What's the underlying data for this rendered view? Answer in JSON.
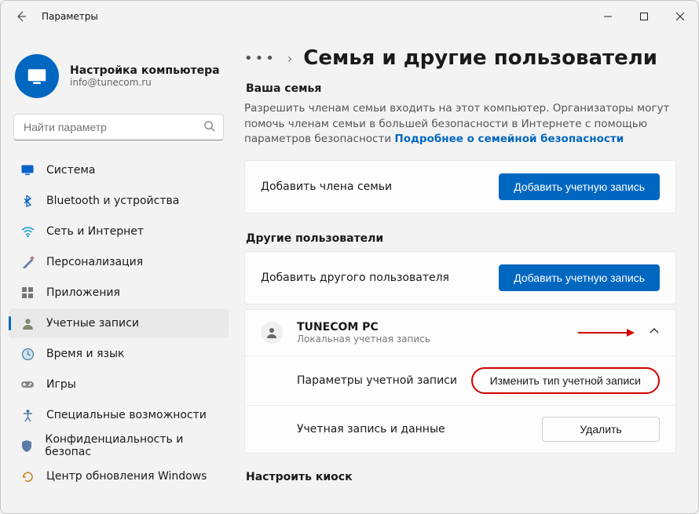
{
  "window": {
    "title": "Параметры"
  },
  "profile": {
    "name": "Настройка компьютера",
    "email": "info@tunecom.ru"
  },
  "search": {
    "placeholder": "Найти параметр"
  },
  "nav": {
    "items": [
      {
        "label": "Система",
        "icon": "system"
      },
      {
        "label": "Bluetooth и устройства",
        "icon": "bluetooth"
      },
      {
        "label": "Сеть и Интернет",
        "icon": "network"
      },
      {
        "label": "Персонализация",
        "icon": "personalize"
      },
      {
        "label": "Приложения",
        "icon": "apps"
      },
      {
        "label": "Учетные записи",
        "icon": "accounts",
        "active": true
      },
      {
        "label": "Время и язык",
        "icon": "time"
      },
      {
        "label": "Игры",
        "icon": "gaming"
      },
      {
        "label": "Специальные возможности",
        "icon": "accessibility"
      },
      {
        "label": "Конфиденциальность и безопас",
        "icon": "privacy"
      },
      {
        "label": "Центр обновления Windows",
        "icon": "update"
      }
    ]
  },
  "breadcrumb": {
    "title": "Семья и другие пользователи"
  },
  "sections": {
    "family": {
      "label": "Ваша семья",
      "desc_prefix": "Разрешить членам семьи входить на этот компьютер. Организаторы могут помочь членам семьи в большей безопасности в Интернете с помощью параметров безопасности ",
      "desc_link": "Подробнее о семейной безопасности",
      "add_member": "Добавить члена семьи",
      "add_button": "Добавить учетную запись"
    },
    "other": {
      "label": "Другие пользователи",
      "add_user": "Добавить другого пользователя",
      "add_button": "Добавить учетную запись"
    },
    "user": {
      "name": "TUNECOM PC",
      "type": "Локальная учетная запись",
      "params_label": "Параметры учетной записи",
      "change_type": "Изменить тип учетной записи",
      "data_label": "Учетная запись и данные",
      "remove": "Удалить"
    },
    "kiosk": {
      "label": "Настроить киоск"
    }
  }
}
